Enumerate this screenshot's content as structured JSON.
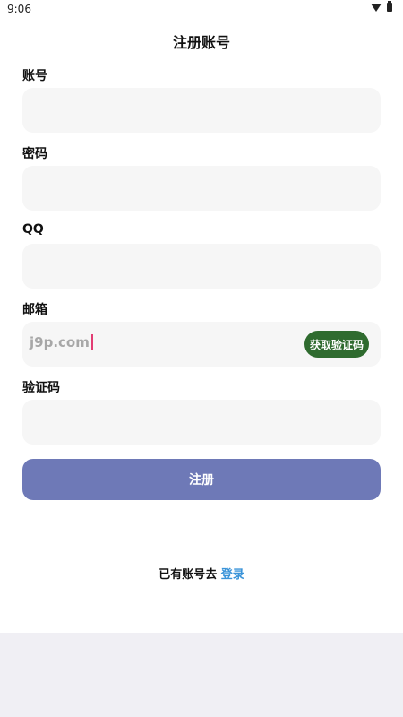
{
  "status": {
    "time": "9:06",
    "wifi_icon": "wifi-icon",
    "battery_icon": "battery-icon"
  },
  "page": {
    "title": "注册账号"
  },
  "form": {
    "account_label": "账号",
    "password_label": "密码",
    "qq_label": "QQ",
    "email_label": "邮箱",
    "email_value": "j9p.com",
    "get_code_label": "获取验证码",
    "code_label": "验证码",
    "submit_label": "注册"
  },
  "footer": {
    "prompt": "已有账号去",
    "login_link": "登录"
  },
  "colors": {
    "submit": "#6e79b7",
    "code_button": "#2f6b2f",
    "link": "#3b94d9",
    "field_bg": "#f6f6f6"
  }
}
